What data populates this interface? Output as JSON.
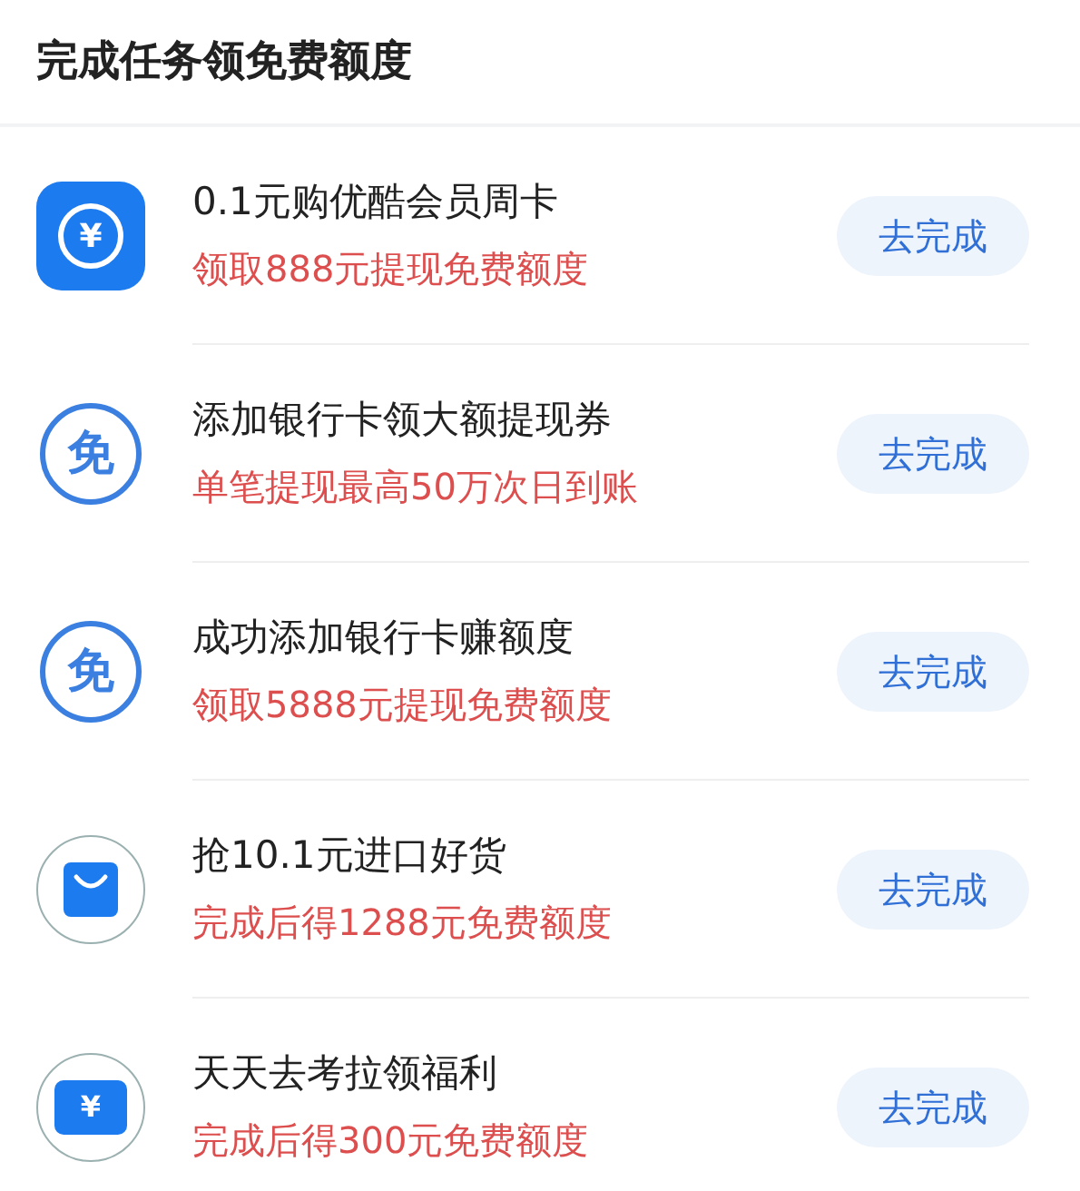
{
  "header": {
    "title": "完成任务领免费额度"
  },
  "tasks": [
    {
      "kind": "coin",
      "glyph": "¥",
      "title": "0.1元购优酷会员周卡",
      "subtitle": "领取888元提现免费额度",
      "button": "去完成"
    },
    {
      "kind": "free",
      "glyph": "免",
      "title": "添加银行卡领大额提现券",
      "subtitle": "单笔提现最高50万次日到账",
      "button": "去完成"
    },
    {
      "kind": "free",
      "glyph": "免",
      "title": "成功添加银行卡赚额度",
      "subtitle": "领取5888元提现免费额度",
      "button": "去完成"
    },
    {
      "kind": "bag",
      "title": "抢10.1元进口好货",
      "subtitle": "完成后得1288元免费额度",
      "button": "去完成"
    },
    {
      "kind": "ticket",
      "glyph": "¥",
      "title": "天天去考拉领福利",
      "subtitle": "完成后得300元免费额度",
      "button": "去完成"
    }
  ]
}
